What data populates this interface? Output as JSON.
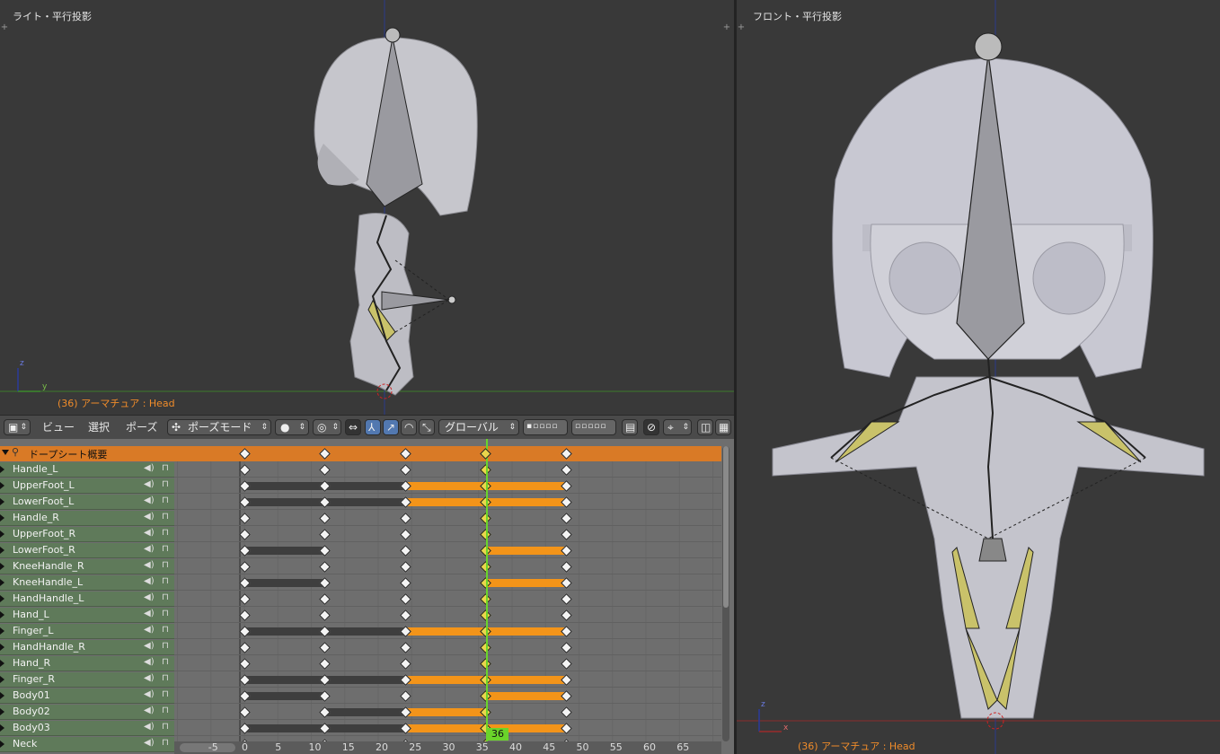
{
  "left_view": {
    "title": "ライト・平行投影",
    "status": "(36) アーマチュア : Head",
    "axis_z": "z",
    "axis_y": "y"
  },
  "right_view": {
    "title": "フロント・平行投影",
    "status": "(36) アーマチュア : Head",
    "axis_z": "z",
    "axis_x": "x"
  },
  "header": {
    "menu_view": "ビュー",
    "menu_select": "選択",
    "menu_pose": "ポーズ",
    "mode": "ポーズモード",
    "orientation": "グローバル"
  },
  "dopesheet": {
    "summary": "ドープシート概要",
    "current_frame": "36",
    "channels": [
      {
        "name": "Handle_L"
      },
      {
        "name": "UpperFoot_L"
      },
      {
        "name": "LowerFoot_L"
      },
      {
        "name": "Handle_R"
      },
      {
        "name": "UpperFoot_R"
      },
      {
        "name": "LowerFoot_R"
      },
      {
        "name": "KneeHandle_R"
      },
      {
        "name": "KneeHandle_L"
      },
      {
        "name": "HandHandle_L"
      },
      {
        "name": "Hand_L"
      },
      {
        "name": "Finger_L"
      },
      {
        "name": "HandHandle_R"
      },
      {
        "name": "Hand_R"
      },
      {
        "name": "Finger_R"
      },
      {
        "name": "Body01"
      },
      {
        "name": "Body02"
      },
      {
        "name": "Body03"
      },
      {
        "name": "Neck"
      }
    ],
    "keyframes": [
      0,
      12,
      24,
      36,
      48
    ],
    "holds": [
      {
        "dark": [],
        "orange": []
      },
      {
        "dark": [
          [
            0,
            24
          ]
        ],
        "orange": [
          [
            24,
            48
          ]
        ]
      },
      {
        "dark": [
          [
            0,
            24
          ]
        ],
        "orange": [
          [
            24,
            48
          ]
        ]
      },
      {
        "dark": [],
        "orange": []
      },
      {
        "dark": [],
        "orange": []
      },
      {
        "dark": [
          [
            0,
            12
          ]
        ],
        "orange": [
          [
            36,
            48
          ]
        ]
      },
      {
        "dark": [],
        "orange": []
      },
      {
        "dark": [
          [
            0,
            12
          ]
        ],
        "orange": [
          [
            36,
            48
          ]
        ]
      },
      {
        "dark": [],
        "orange": []
      },
      {
        "dark": [],
        "orange": []
      },
      {
        "dark": [
          [
            0,
            24
          ]
        ],
        "orange": [
          [
            24,
            48
          ]
        ]
      },
      {
        "dark": [],
        "orange": []
      },
      {
        "dark": [],
        "orange": []
      },
      {
        "dark": [
          [
            0,
            24
          ]
        ],
        "orange": [
          [
            24,
            48
          ]
        ]
      },
      {
        "dark": [
          [
            0,
            12
          ]
        ],
        "orange": [
          [
            36,
            48
          ]
        ]
      },
      {
        "dark": [
          [
            12,
            24
          ]
        ],
        "orange": [
          [
            24,
            36
          ]
        ]
      },
      {
        "dark": [
          [
            0,
            24
          ]
        ],
        "orange": [
          [
            24,
            48
          ]
        ]
      },
      {
        "dark": [],
        "orange": []
      }
    ],
    "ruler_labels": [
      "-5",
      "0",
      "5",
      "10",
      "15",
      "20",
      "25",
      "30",
      "35",
      "40",
      "45",
      "50",
      "55",
      "60",
      "65"
    ]
  },
  "colors": {
    "accent": "#f39419",
    "channel_bg": "#5f7a5a",
    "summary_bg": "#d97a26",
    "viewport_bg": "#393939",
    "bone_yellow": "#c9c26a",
    "playhead": "#6ad42a"
  }
}
